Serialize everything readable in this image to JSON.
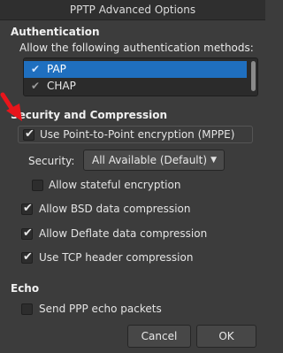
{
  "window": {
    "title": "PPTP Advanced Options"
  },
  "authentication": {
    "heading": "Authentication",
    "description": "Allow the following authentication methods:",
    "methods": [
      {
        "label": "PAP",
        "checked": true,
        "selected": true
      },
      {
        "label": "CHAP",
        "checked": true,
        "selected": false
      }
    ]
  },
  "security": {
    "heading": "Security and Compression",
    "mppe_label": "Use Point-to-Point encryption (MPPE)",
    "security_label": "Security:",
    "security_value": "All Available (Default)",
    "stateful_label": "Allow stateful encryption",
    "bsd_label": "Allow BSD data compression",
    "deflate_label": "Allow Deflate data compression",
    "tcp_header_label": "Use TCP header compression"
  },
  "echo": {
    "heading": "Echo",
    "send_echo_label": "Send PPP echo packets"
  },
  "buttons": {
    "cancel": "Cancel",
    "ok": "OK"
  },
  "colors": {
    "background": "#3c3c3c",
    "selection": "#1f6fbf",
    "annotation_arrow": "#e8151b"
  },
  "icons": {
    "check": "checkmark-icon",
    "dropdown": "chevron-down-icon",
    "annotation": "red-arrow-icon"
  }
}
